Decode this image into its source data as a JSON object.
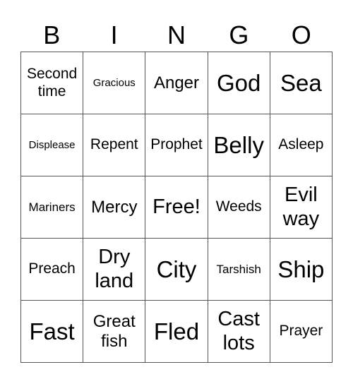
{
  "header": {
    "letters": [
      "B",
      "I",
      "N",
      "G",
      "O"
    ]
  },
  "card": {
    "rows": [
      [
        "Second time",
        "Gracious",
        "Anger",
        "God",
        "Sea"
      ],
      [
        "Displease",
        "Repent",
        "Prophet",
        "Belly",
        "Asleep"
      ],
      [
        "Mariners",
        "Mercy",
        "Free!",
        "Weeds",
        "Evil way"
      ],
      [
        "Preach",
        "Dry land",
        "City",
        "Tarshish",
        "Ship"
      ],
      [
        "Fast",
        "Great fish",
        "Fled",
        "Cast lots",
        "Prayer"
      ]
    ]
  }
}
